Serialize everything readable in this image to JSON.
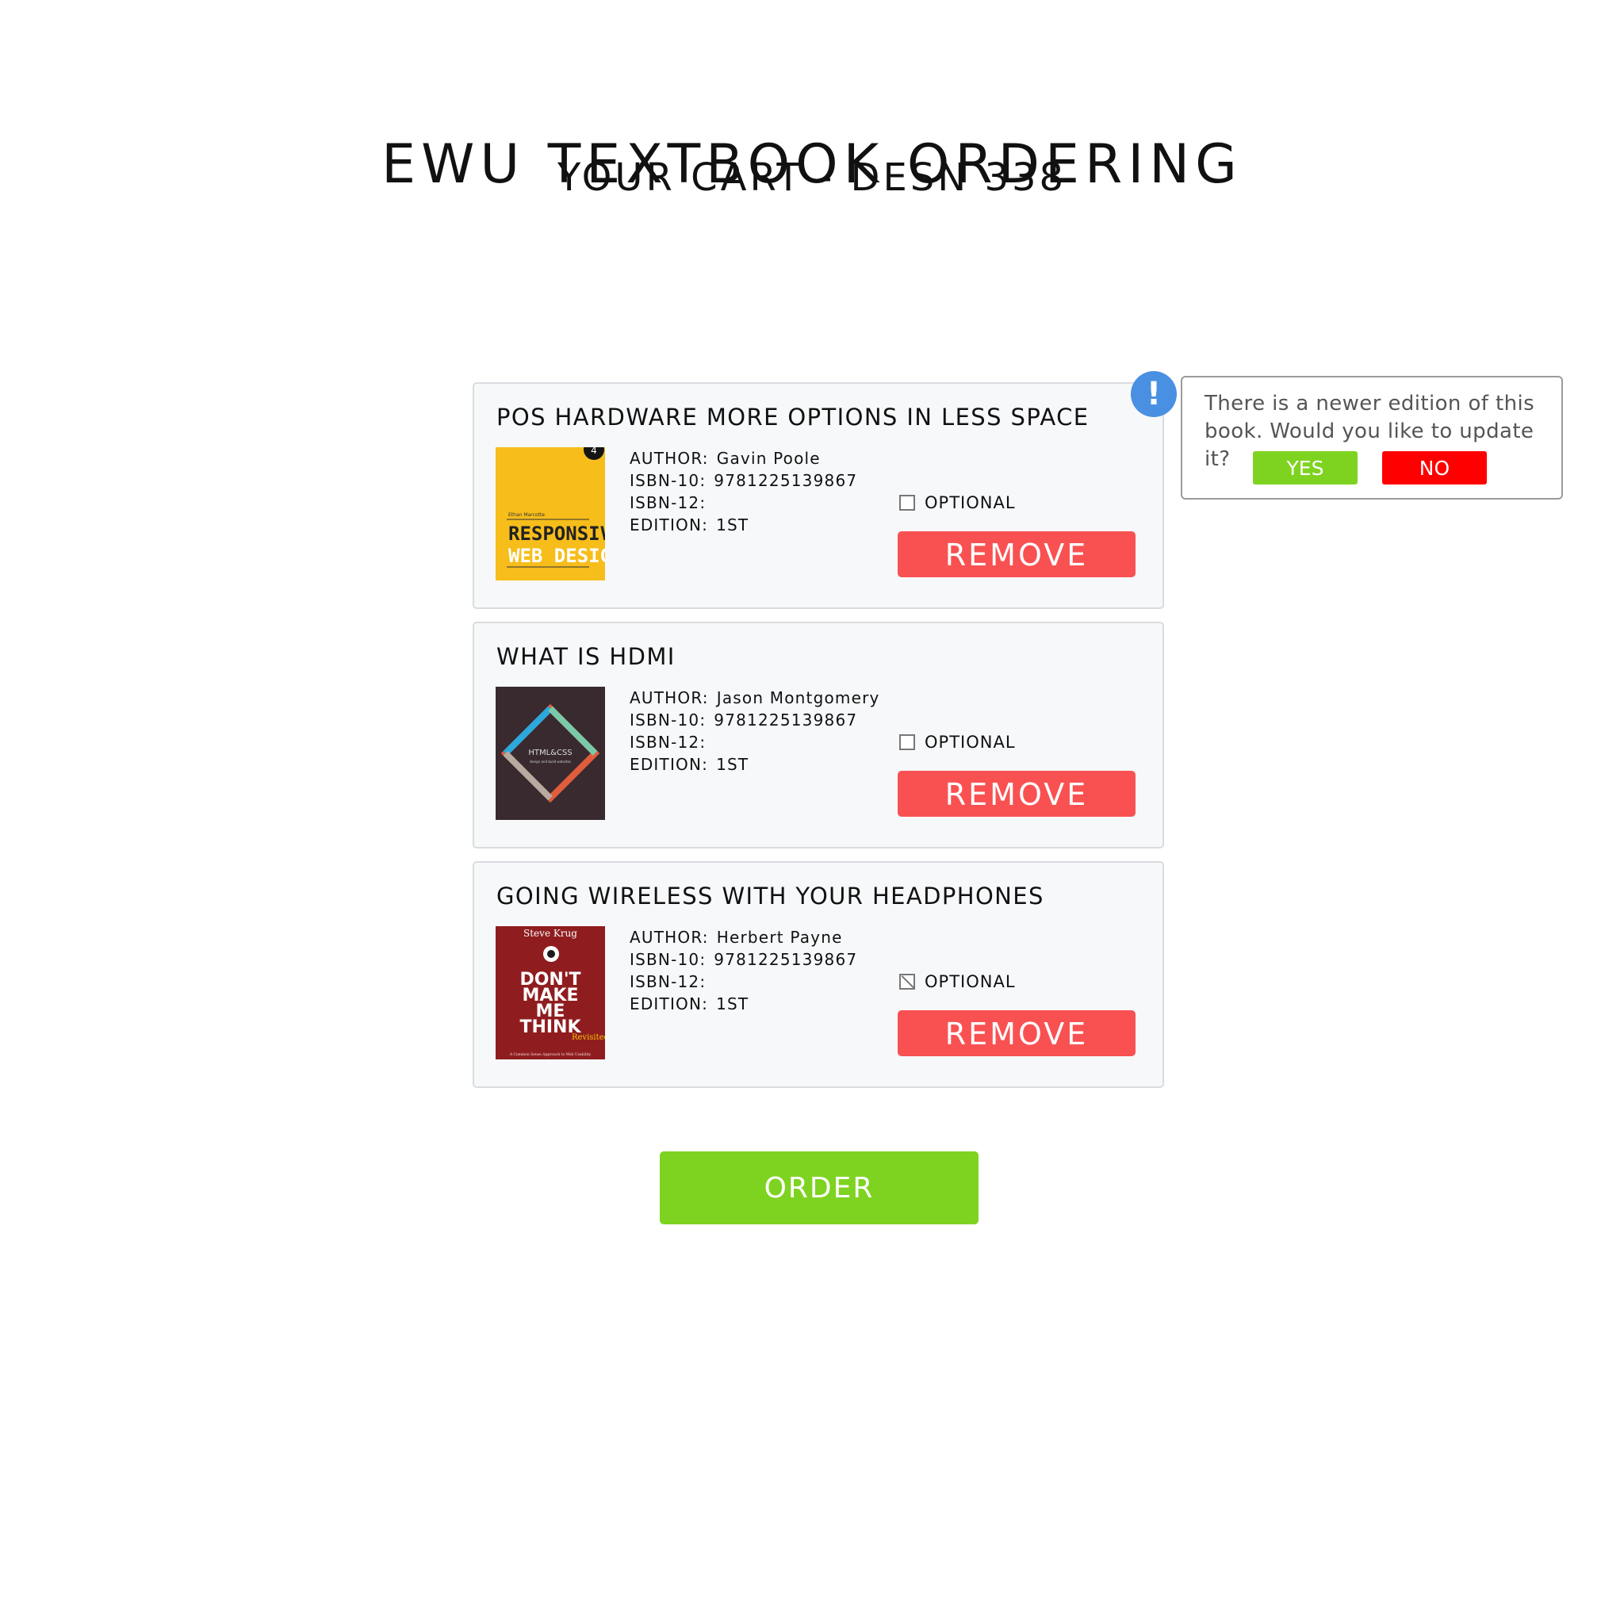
{
  "header": {
    "title": "EWU TEXTBOOK ORDERING",
    "subtitle": "YOUR CART - DESN 338"
  },
  "books": [
    {
      "title": "POS HARDWARE MORE OPTIONS IN LESS SPACE",
      "author_label": "AUTHOR:",
      "author": "Gavin Poole",
      "isbn10_label": "ISBN-10:",
      "isbn10": "9781225139867",
      "isbn12_label": "ISBN-12:",
      "isbn12": "",
      "edition_label": "EDITION:",
      "edition": "1ST",
      "optional_label": "OPTIONAL",
      "optional_checked": false,
      "remove_label": "REMOVE",
      "cover_text_1": "RESPONSIVE",
      "cover_text_2": "WEB DESIGN",
      "cover_badge": "4",
      "cover_top_text": "Ethan Marcotte"
    },
    {
      "title": "WHAT IS HDMI",
      "author_label": "AUTHOR:",
      "author": "Jason Montgomery",
      "isbn10_label": "ISBN-10:",
      "isbn10": "9781225139867",
      "isbn12_label": "ISBN-12:",
      "isbn12": "",
      "edition_label": "EDITION:",
      "edition": "1ST",
      "optional_label": "OPTIONAL",
      "optional_checked": false,
      "remove_label": "REMOVE",
      "cover_text_1": "HTML&CSS",
      "cover_text_2": "design and build websites"
    },
    {
      "title": "GOING WIRELESS WITH YOUR HEADPHONES",
      "author_label": "AUTHOR:",
      "author": "Herbert Payne",
      "isbn10_label": "ISBN-10:",
      "isbn10": "9781225139867",
      "isbn12_label": "ISBN-12:",
      "isbn12": "",
      "edition_label": "EDITION:",
      "edition": "1ST",
      "optional_label": "OPTIONAL",
      "optional_checked": true,
      "remove_label": "REMOVE",
      "cover_author": "Steve Krug",
      "cover_text_1": "DON'T",
      "cover_text_2": "MAKE",
      "cover_text_3": "ME",
      "cover_text_4": "THINK",
      "cover_text_5": "Revisited",
      "cover_text_6": "A Common Sense Approach to Web Usability"
    }
  ],
  "popup": {
    "message": "There is a newer edition of this book. Would you like to update it?",
    "yes_label": "YES",
    "no_label": "NO",
    "alert_symbol": "!"
  },
  "actions": {
    "order_label": "ORDER"
  },
  "colors": {
    "remove": "#f95152",
    "order": "#7ed321",
    "yes": "#7ed321",
    "no": "#ff0000",
    "alert": "#4a90e2"
  },
  "icons": {
    "alert": "exclamation-icon",
    "checkbox": "checkbox-icon"
  }
}
